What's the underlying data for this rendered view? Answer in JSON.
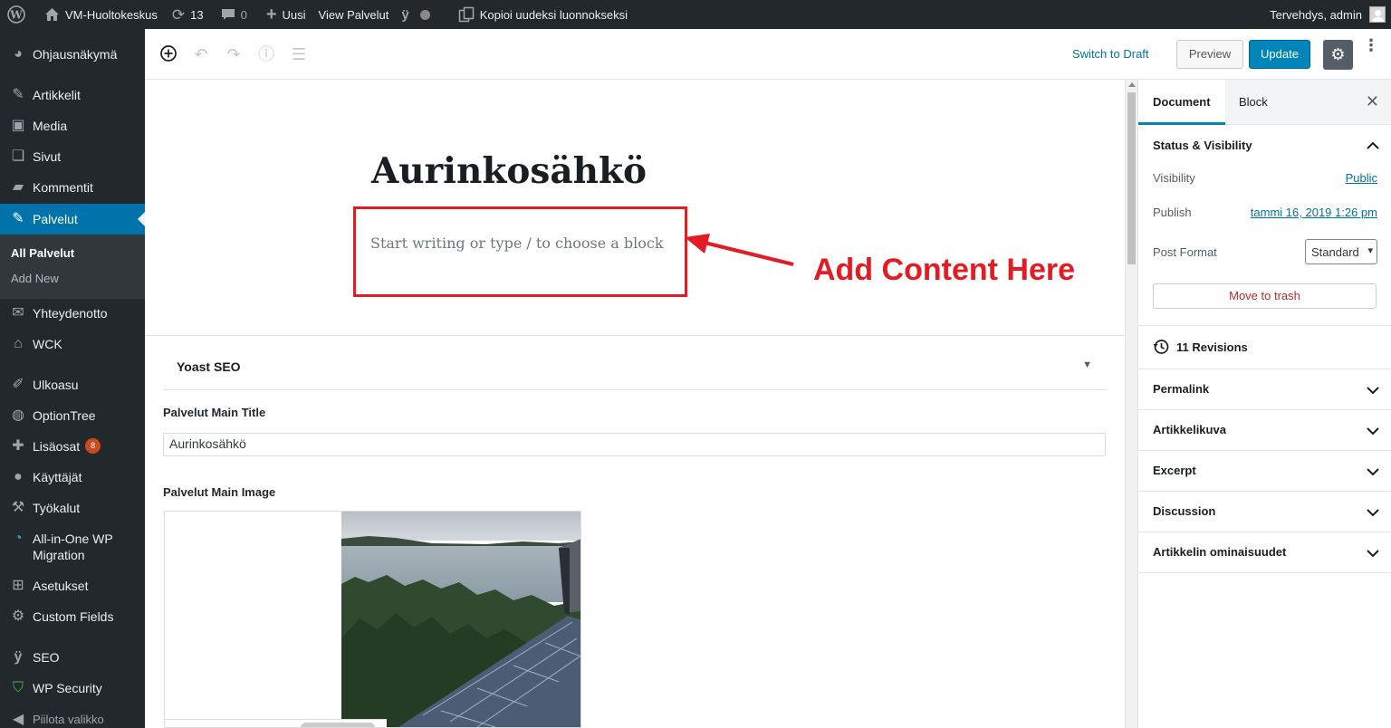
{
  "adminbar": {
    "site_name": "VM-Huoltokeskus",
    "updates_count": "13",
    "comments_count": "0",
    "new_label": "Uusi",
    "view_label": "View Palvelut",
    "duplicate_label": "Kopioi uudeksi luonnokseksi",
    "greeting": "Tervehdys, admin"
  },
  "sidebar": {
    "dashboard": "Ohjausnäkymä",
    "posts": "Artikkelit",
    "media": "Media",
    "pages": "Sivut",
    "comments": "Kommentit",
    "palvelut": "Palvelut",
    "submenu_all": "All Palvelut",
    "submenu_new": "Add New",
    "contact": "Yhteydenotto",
    "wck": "WCK",
    "appearance": "Ulkoasu",
    "optiontree": "OptionTree",
    "plugins": "Lisäosat",
    "plugins_badge": "8",
    "users": "Käyttäjät",
    "tools": "Työkalut",
    "migration": "All-in-One WP Migration",
    "settings": "Asetukset",
    "custom_fields": "Custom Fields",
    "seo": "SEO",
    "security": "WP Security",
    "collapse": "Piilota valikko"
  },
  "toolbar": {
    "switch_draft": "Switch to Draft",
    "preview": "Preview",
    "update": "Update"
  },
  "editor": {
    "title": "Aurinkosähkö",
    "placeholder": "Start writing or type / to choose a block",
    "annotation": "Add Content Here",
    "annotation_color": "#e31b23"
  },
  "meta": {
    "yoast_title": "Yoast SEO",
    "main_title_label": "Palvelut Main Title",
    "main_title_value": "Aurinkosähkö",
    "main_image_label": "Palvelut Main Image"
  },
  "settings_panel": {
    "tab_document": "Document",
    "tab_block": "Block",
    "status_title": "Status & Visibility",
    "visibility_label": "Visibility",
    "visibility_value": "Public",
    "publish_label": "Publish",
    "publish_value": "tammi 16, 2019 1:26 pm",
    "format_label": "Post Format",
    "format_value": "Standard",
    "trash": "Move to trash",
    "revisions": "11 Revisions",
    "permalink": "Permalink",
    "featured_image": "Artikkelikuva",
    "excerpt": "Excerpt",
    "discussion": "Discussion",
    "attributes": "Artikkelin ominaisuudet"
  },
  "colors": {
    "admin_dark": "#23282d",
    "accent": "#0073aa",
    "primary_button": "#0085ba"
  }
}
